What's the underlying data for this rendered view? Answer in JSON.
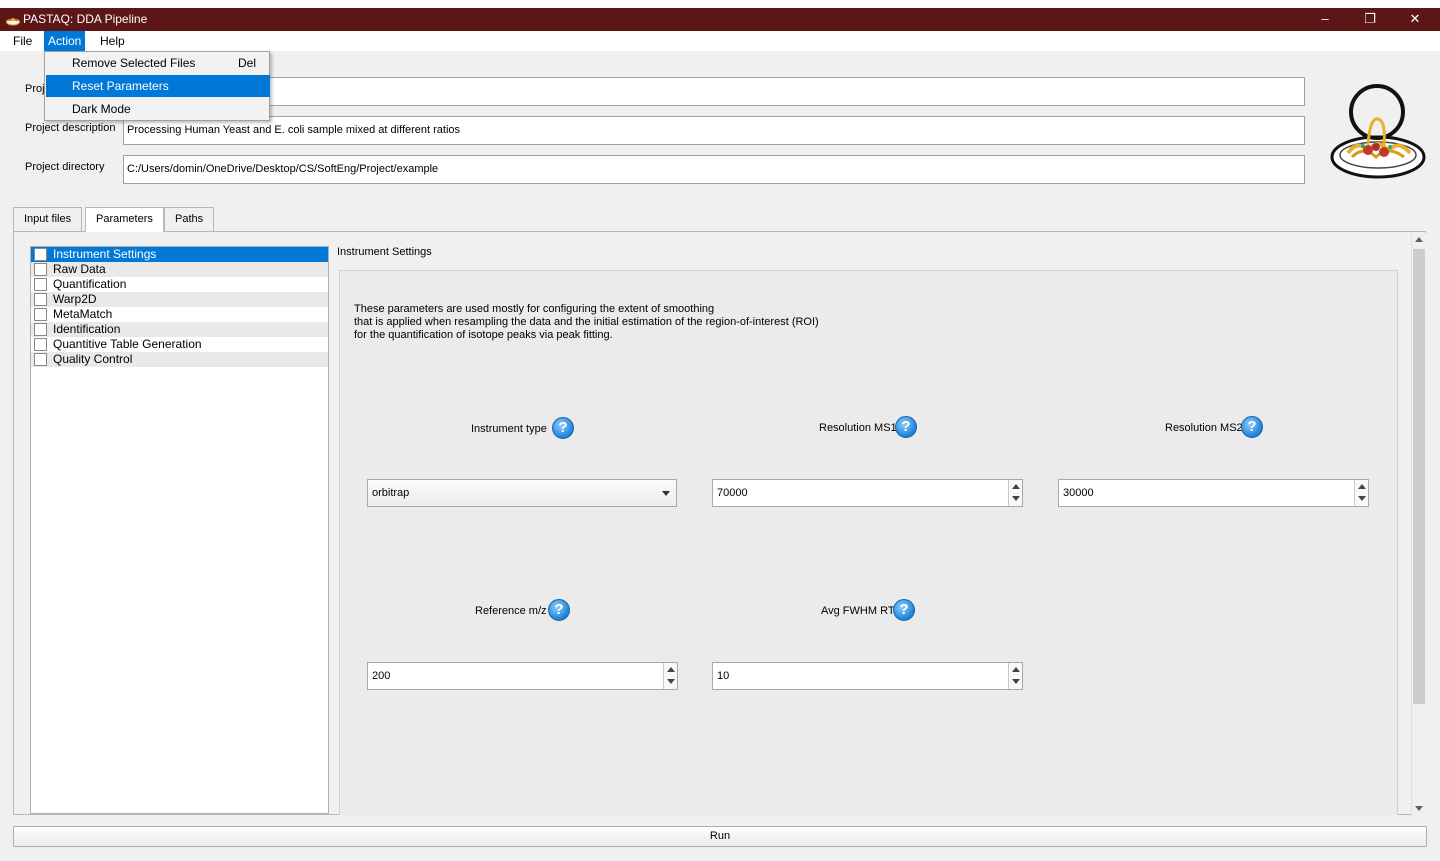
{
  "window": {
    "title": "PASTAQ: DDA Pipeline",
    "controls": {
      "minimize": "–",
      "maximize": "❐",
      "close": "✕"
    }
  },
  "menubar": {
    "items": [
      {
        "label": "File"
      },
      {
        "label": "Action",
        "active": true
      },
      {
        "label": "Help"
      }
    ]
  },
  "action_menu": {
    "items": [
      {
        "label": "Remove Selected Files",
        "shortcut": "Del"
      },
      {
        "label": "Reset Parameters",
        "shortcut": "",
        "highlighted": true
      },
      {
        "label": "Dark Mode",
        "shortcut": ""
      }
    ]
  },
  "project": {
    "name_label_visible": "Proj",
    "name_value": "",
    "description_label": "Project description",
    "description_value": "Processing Human Yeast and E. coli sample mixed at different ratios",
    "directory_label": "Project directory",
    "directory_value": "C:/Users/domin/OneDrive/Desktop/CS/SoftEng/Project/example"
  },
  "tabs": [
    {
      "label": "Input files",
      "active": false
    },
    {
      "label": "Parameters",
      "active": true
    },
    {
      "label": "Paths",
      "active": false
    }
  ],
  "tree": {
    "items": [
      {
        "label": "Instrument Settings",
        "selected": true
      },
      {
        "label": "Raw Data"
      },
      {
        "label": "Quantification"
      },
      {
        "label": "Warp2D"
      },
      {
        "label": "MetaMatch"
      },
      {
        "label": "Identification"
      },
      {
        "label": "Quantitive Table Generation"
      },
      {
        "label": "Quality Control"
      }
    ]
  },
  "section": {
    "title": "Instrument Settings",
    "description": [
      "These parameters are used mostly for configuring the extent of smoothing",
      "that is applied when resampling the data and the initial estimation of the region-of-interest (ROI)",
      "for the quantification of isotope peaks via peak fitting."
    ]
  },
  "params": {
    "instrument_type": {
      "label": "Instrument type",
      "value": "orbitrap"
    },
    "resolution_ms1": {
      "label": "Resolution MS1",
      "value": "70000"
    },
    "resolution_ms2": {
      "label": "Resolution MS2",
      "value": "30000"
    },
    "reference_mz": {
      "label": "Reference m/z",
      "value": "200"
    },
    "avg_fwhm_rt": {
      "label": "Avg FWHM RT",
      "value": "10"
    }
  },
  "help_icon_glyph": "?",
  "run_button": {
    "label": "Run"
  },
  "colors": {
    "titlebar": "#5c1616",
    "accent": "#0078d7",
    "help_icon": "#1e7fd6"
  }
}
